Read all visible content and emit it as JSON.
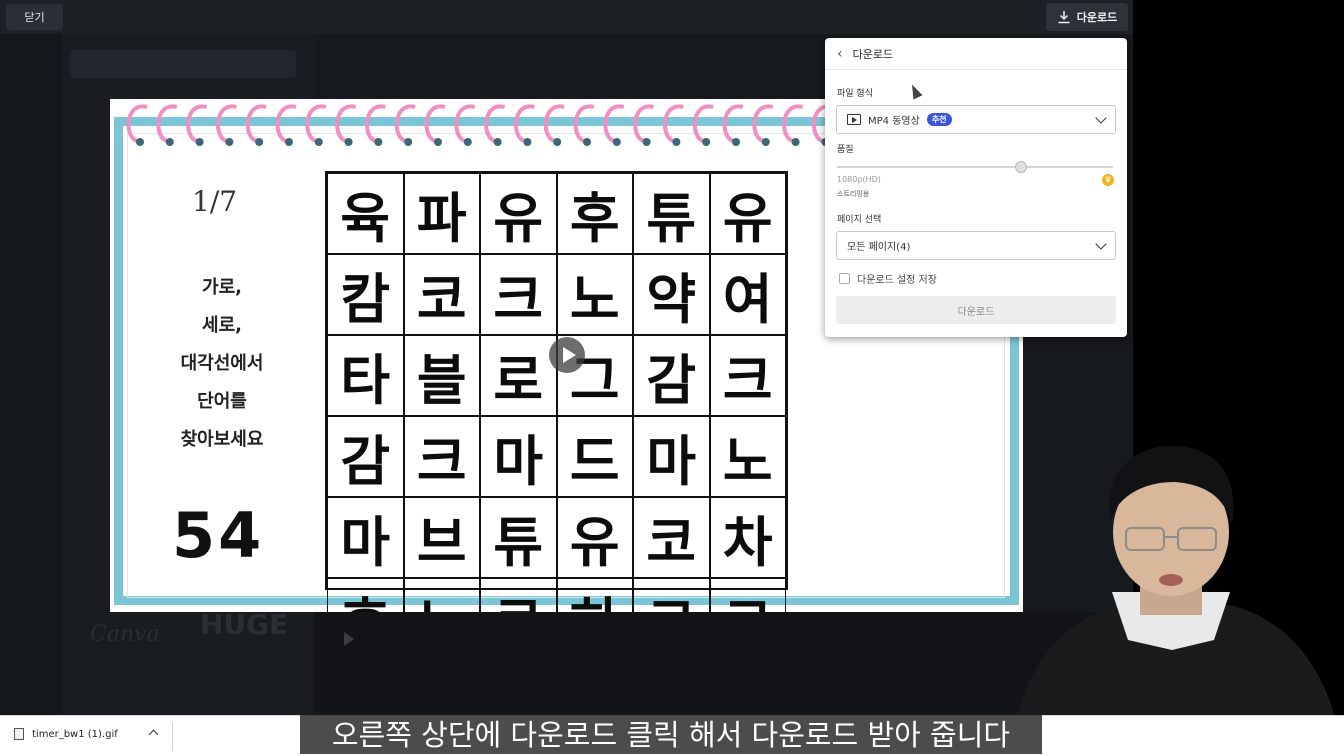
{
  "topbar": {
    "close_label": "닫기",
    "download_label": "다운로드"
  },
  "slide": {
    "counter": "1/7",
    "instructions": [
      "가로,",
      "세로,",
      "대각선에서",
      "단어를",
      "찾아보세요"
    ],
    "timer": "54",
    "grid": [
      [
        "육",
        "파",
        "유",
        "후",
        "튜",
        "유"
      ],
      [
        "캄",
        "코",
        "크",
        "노",
        "약",
        "여"
      ],
      [
        "타",
        "블",
        "로",
        "그",
        "감",
        "크"
      ],
      [
        "감",
        "크",
        "마",
        "드",
        "마",
        "노"
      ],
      [
        "마",
        "브",
        "튜",
        "유",
        "코",
        "차"
      ],
      [
        "후",
        "노",
        "로",
        "하",
        "코",
        "코"
      ]
    ]
  },
  "panel": {
    "title": "다운로드",
    "file_type_label": "파일 형식",
    "file_type_value": "MP4 동영상",
    "recommended_badge": "추천",
    "quality_label": "품질",
    "quality_value": "1080p(HD)",
    "quality_sub": "스트리밍용",
    "page_select_label": "페이지 선택",
    "page_select_value": "모든 페이지(4)",
    "save_settings_label": "다운로드 설정 저장",
    "download_button": "다운로드"
  },
  "download_bar": {
    "file_name": "timer_bw1 (1).gif"
  },
  "subtitle": "오른쪽 상단에 다운로드 클릭 해서 다운로드 받아 줍니다",
  "colors": {
    "slide_border": "#7bc6d6",
    "spiral_ring": "#f08fc4",
    "badge": "#3a55d9",
    "crown": "#f3b31b"
  }
}
